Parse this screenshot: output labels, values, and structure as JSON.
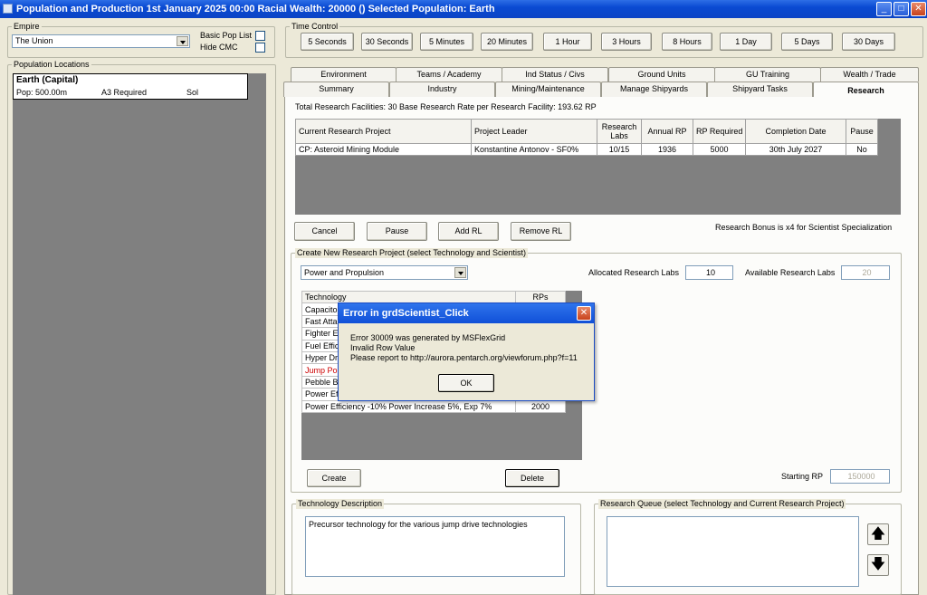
{
  "window": {
    "title": "Population and Production  1st January 2025 00:00   Racial Wealth: 20000 ()   Selected Population: Earth",
    "min": "_",
    "max": "□",
    "close": "✕"
  },
  "empire": {
    "label": "Empire",
    "value": "The Union",
    "basic_pop_list": "Basic Pop List",
    "hide_cmc": "Hide CMC"
  },
  "time_control": {
    "label": "Time Control",
    "buttons": [
      "5 Seconds",
      "30 Seconds",
      "5 Minutes",
      "20 Minutes",
      "1 Hour",
      "3 Hours",
      "8 Hours",
      "1 Day",
      "5 Days",
      "30 Days"
    ]
  },
  "pop_locations": {
    "label": "Population Locations",
    "name": "Earth (Capital)",
    "pop": "Pop: 500.00m",
    "req": "A3 Required",
    "system": "Sol"
  },
  "tabs_top": [
    "Environment",
    "Teams / Academy",
    "Ind Status / Civs",
    "Ground Units",
    "GU Training",
    "Wealth / Trade"
  ],
  "tabs_bottom": [
    "Summary",
    "Industry",
    "Mining/Maintenance",
    "Manage Shipyards",
    "Shipyard Tasks",
    "Research"
  ],
  "research": {
    "facilities": "Total Research Facilities: 30   Base Research Rate per Research Facility: 193.62 RP",
    "headers": [
      "Current Research Project",
      "Project Leader",
      "Research Labs",
      "Annual RP",
      "RP Required",
      "Completion Date",
      "Pause"
    ],
    "row": [
      "CP: Asteroid Mining Module",
      "Konstantine Antonov - SF0%",
      "10/15",
      "1936",
      "5000",
      "30th July 2027",
      "No"
    ],
    "cancel": "Cancel",
    "pause": "Pause",
    "add_rl": "Add RL",
    "remove_rl": "Remove RL",
    "bonus": "Research Bonus is x4 for Scientist Specialization"
  },
  "create_project": {
    "label": "Create New Research Project (select Technology and Scientist)",
    "field": "Power and Propulsion",
    "allocated_label": "Allocated Research Labs",
    "allocated_value": "10",
    "available_label": "Available Research Labs",
    "available_value": "20",
    "tech_header": "Technology",
    "rps_header": "RPs",
    "techs": [
      "Capacito",
      "Fast Atta",
      "Fighter E",
      "Fuel Effic",
      "Hyper Dr",
      "Jump Poi",
      "Pebble B",
      "Power Ef",
      "Power Efficiency -10% Power Increase 5%, Exp 7%"
    ],
    "last_rps": "2000",
    "highlight_color": "#cc0000",
    "create": "Create",
    "delete": "Delete",
    "starting_rp_label": "Starting RP",
    "starting_rp_value": "150000"
  },
  "description": {
    "label": "Technology Description",
    "text": "Precursor technology for the various jump drive technologies"
  },
  "queue": {
    "label": "Research Queue (select Technology and Current Research Project)"
  },
  "error_dialog": {
    "title": "Error in grdScientist_Click",
    "line1": "Error 30009 was generated by MSFlexGrid",
    "line2": "Invalid Row Value",
    "line3": "Please report to http://aurora.pentarch.org/viewforum.php?f=11",
    "ok": "OK",
    "close": "✕"
  }
}
